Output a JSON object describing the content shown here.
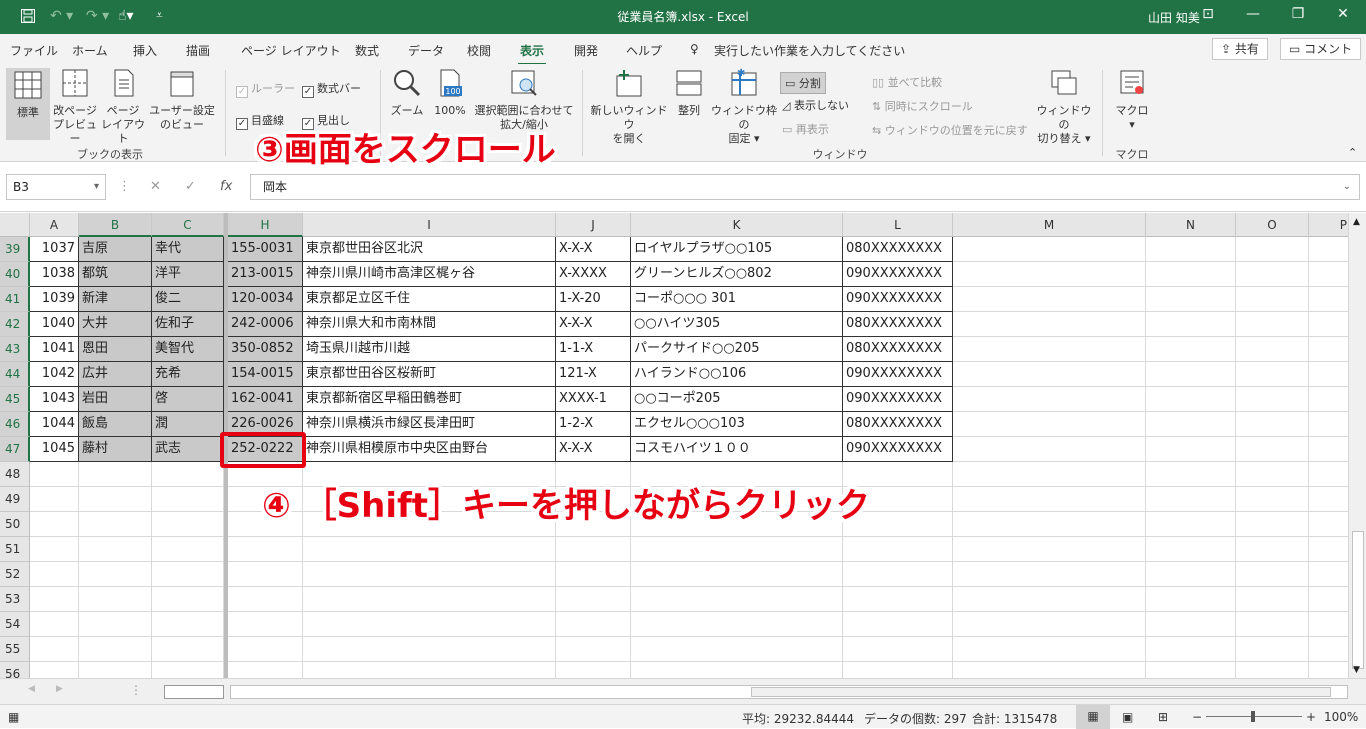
{
  "titlebar": {
    "title": "従業員名簿.xlsx  -  Excel",
    "user": "山田 知美"
  },
  "tabs": [
    "ファイル",
    "ホーム",
    "挿入",
    "描画",
    "ページ レイアウト",
    "数式",
    "データ",
    "校閲",
    "表示",
    "開発",
    "ヘルプ"
  ],
  "tell_me": "実行したい作業を入力してください",
  "share": "共有",
  "comment": "コメント",
  "ribbon": {
    "workbook_views": {
      "normal": "標準",
      "page_break": [
        "改ページ",
        "プレビュー"
      ],
      "page_layout": [
        "ページ",
        "レイアウト"
      ],
      "custom": [
        "ユーザー設定",
        "のビュー"
      ],
      "group": "ブックの表示"
    },
    "show": {
      "ruler": "ルーラー",
      "formula_bar": "数式バー",
      "gridlines": "目盛線",
      "headings": "見出し"
    },
    "zoom": {
      "zoom": "ズーム",
      "hundred": "100%",
      "selection": [
        "選択範囲に合わせて",
        "拡大/縮小"
      ],
      "icon_label": "100"
    },
    "window": {
      "new_window": [
        "新しいウィンドウ",
        "を開く"
      ],
      "arrange": "整列",
      "freeze": [
        "ウィンドウ枠の",
        "固定"
      ],
      "split": "分割",
      "hide": "表示しない",
      "unhide": "再表示",
      "side_by_side": "並べて比較",
      "sync_scroll": "同時にスクロール",
      "reset_pos": "ウィンドウの位置を元に戻す",
      "switch": [
        "ウィンドウの",
        "切り替え"
      ],
      "group": "ウィンドウ"
    },
    "macro": {
      "label": "マクロ",
      "group": "マクロ"
    }
  },
  "namebox": "B3",
  "formula": "岡本",
  "columns": [
    "A",
    "B",
    "C",
    "H",
    "I",
    "J",
    "K",
    "L",
    "M",
    "N",
    "O",
    "P"
  ],
  "rows": [
    {
      "n": "39",
      "a": "1037",
      "b": "吉原",
      "c": "幸代",
      "h": "155-0031",
      "i": "東京都世田谷区北沢",
      "j": "X-X-X",
      "k": "ロイヤルプラザ○○105",
      "l": "080XXXXXXXX"
    },
    {
      "n": "40",
      "a": "1038",
      "b": "都筑",
      "c": "洋平",
      "h": "213-0015",
      "i": "神奈川県川崎市高津区梶ヶ谷",
      "j": "X-XXXX",
      "k": "グリーンヒルズ○○802",
      "l": "090XXXXXXXX"
    },
    {
      "n": "41",
      "a": "1039",
      "b": "新津",
      "c": "俊二",
      "h": "120-0034",
      "i": "東京都足立区千住",
      "j": "1-X-20",
      "k": "コーポ○○○ 301",
      "l": "090XXXXXXXX"
    },
    {
      "n": "42",
      "a": "1040",
      "b": "大井",
      "c": "佐和子",
      "h": "242-0006",
      "i": "神奈川県大和市南林間",
      "j": "X-X-X",
      "k": "○○ハイツ305",
      "l": "080XXXXXXXX"
    },
    {
      "n": "43",
      "a": "1041",
      "b": "恩田",
      "c": "美智代",
      "h": "350-0852",
      "i": "埼玉県川越市川越",
      "j": "1-1-X",
      "k": "パークサイド○○205",
      "l": "080XXXXXXXX"
    },
    {
      "n": "44",
      "a": "1042",
      "b": "広井",
      "c": "充希",
      "h": "154-0015",
      "i": "東京都世田谷区桜新町",
      "j": "121-X",
      "k": "ハイランド○○106",
      "l": "090XXXXXXXX"
    },
    {
      "n": "45",
      "a": "1043",
      "b": "岩田",
      "c": "啓",
      "h": "162-0041",
      "i": "東京都新宿区早稲田鶴巻町",
      "j": "XXXX-1",
      "k": "○○コーポ205",
      "l": "090XXXXXXXX"
    },
    {
      "n": "46",
      "a": "1044",
      "b": "飯島",
      "c": "潤",
      "h": "226-0026",
      "i": "神奈川県横浜市緑区長津田町",
      "j": "1-2-X",
      "k": "エクセル○○○103",
      "l": "080XXXXXXXX"
    },
    {
      "n": "47",
      "a": "1045",
      "b": "藤村",
      "c": "武志",
      "h": "252-0222",
      "i": "神奈川県相模原市中央区由野台",
      "j": "X-X-X",
      "k": "コスモハイツ１００",
      "l": "090XXXXXXXX"
    }
  ],
  "empty_rows": [
    "48",
    "49",
    "50",
    "51",
    "52",
    "53",
    "54",
    "55",
    "56"
  ],
  "annotations": {
    "scroll": "③画面をスクロール",
    "shift": "④ ［Shift］キーを押しながらクリック"
  },
  "status": {
    "average": "平均: 29232.84444",
    "count": "データの個数: 297",
    "sum": "合計: 1315478",
    "zoom": "100%"
  }
}
